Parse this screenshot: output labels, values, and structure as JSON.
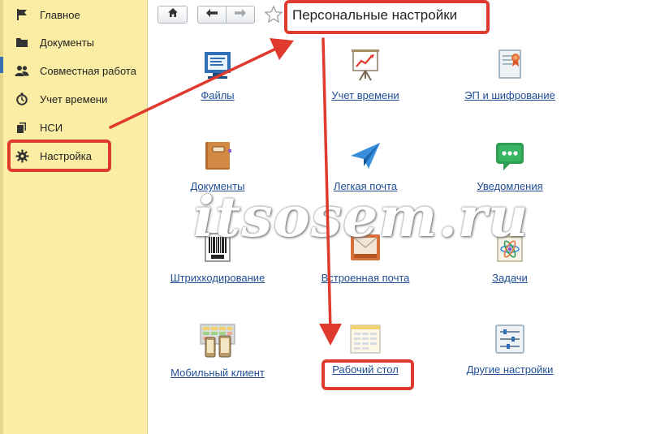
{
  "sidebar": {
    "items": [
      {
        "label": "Главное",
        "icon": "flag-icon"
      },
      {
        "label": "Документы",
        "icon": "folder-icon"
      },
      {
        "label": "Совместная работа",
        "icon": "users-icon"
      },
      {
        "label": "Учет времени",
        "icon": "stopwatch-icon"
      },
      {
        "label": "НСИ",
        "icon": "books-icon"
      },
      {
        "label": "Настройка",
        "icon": "gear-icon",
        "highlighted": true
      }
    ]
  },
  "toolbar": {
    "home_icon": "home-icon",
    "back_icon": "arrow-left-icon",
    "forward_icon": "arrow-right-icon",
    "favorite_icon": "star-icon"
  },
  "page": {
    "title": "Персональные настройки"
  },
  "tiles": [
    {
      "label": "Файлы",
      "icon": "files-icon"
    },
    {
      "label": "Учет времени",
      "icon": "presentation-chart-icon"
    },
    {
      "label": "ЭП и шифрование",
      "icon": "certificate-icon"
    },
    {
      "label": "Документы",
      "icon": "document-folder-icon"
    },
    {
      "label": "Легкая почта",
      "icon": "paper-plane-icon"
    },
    {
      "label": "Уведомления",
      "icon": "chat-bubble-icon"
    },
    {
      "label": "Штрихкодирование",
      "icon": "barcode-icon"
    },
    {
      "label": "Встроенная почта",
      "icon": "mail-icon"
    },
    {
      "label": "Задачи",
      "icon": "tasks-icon"
    },
    {
      "label": "Мобильный клиент",
      "icon": "mobile-client-icon"
    },
    {
      "label": "Рабочий стол",
      "icon": "desktop-icon",
      "highlighted": true
    },
    {
      "label": "Другие настройки",
      "icon": "sliders-icon"
    }
  ],
  "watermark": "itsosem.ru",
  "colors": {
    "sidebar_bg": "#fbeea4",
    "link": "#1f4e96",
    "highlight": "#e03a2f"
  }
}
